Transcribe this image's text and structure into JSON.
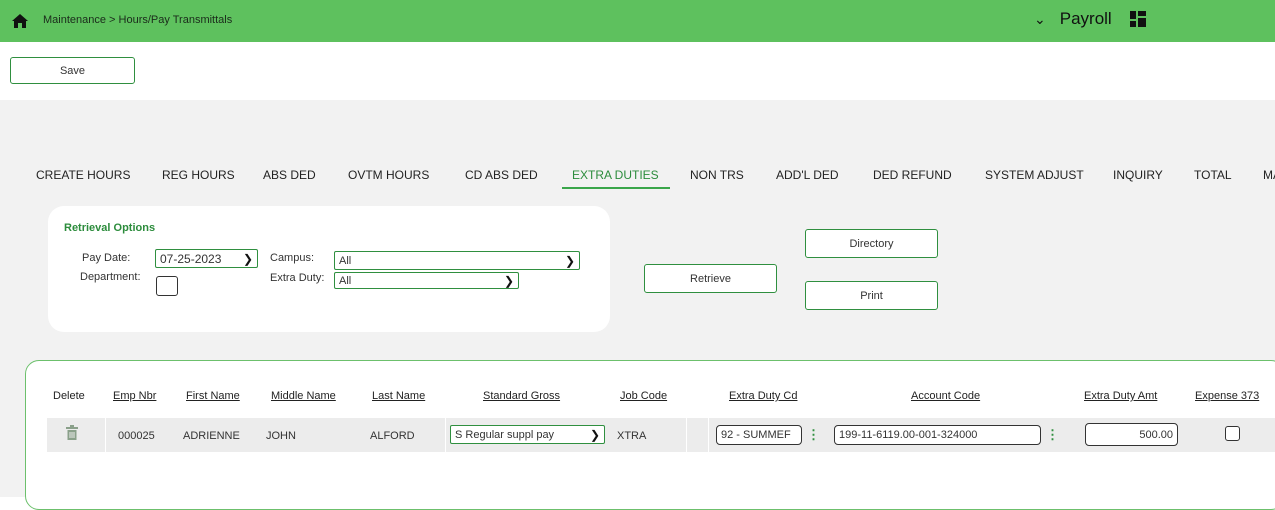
{
  "header": {
    "breadcrumb": "Maintenance > Hours/Pay Transmittals",
    "module": "Payroll",
    "home_icon": "home-icon",
    "apps_icon": "grid-icon"
  },
  "toolbar": {
    "save_label": "Save"
  },
  "tabs": [
    "CREATE HOURS",
    "REG HOURS",
    "ABS DED",
    "OVTM HOURS",
    "CD ABS DED",
    "EXTRA DUTIES",
    "NON TRS",
    "ADD'L DED",
    "DED REFUND",
    "SYSTEM ADJUST",
    "INQUIRY",
    "TOTAL",
    "MA"
  ],
  "active_tab": "EXTRA DUTIES",
  "retrieval": {
    "title": "Retrieval Options",
    "pay_date_label": "Pay Date:",
    "pay_date_value": "07-25-2023",
    "campus_label": "Campus:",
    "campus_value": "All",
    "department_label": "Department:",
    "extra_duty_label": "Extra Duty:",
    "extra_duty_value": "All"
  },
  "buttons": {
    "retrieve": "Retrieve",
    "directory": "Directory",
    "print": "Print"
  },
  "table": {
    "headers": {
      "delete": "Delete",
      "emp_nbr": "Emp Nbr",
      "first_name": "First Name",
      "middle_name": "Middle Name",
      "last_name": "Last Name",
      "standard_gross": "Standard Gross",
      "job_code": "Job Code",
      "extra_duty_cd": "Extra Duty Cd",
      "account_code": "Account Code",
      "extra_duty_amt": "Extra Duty Amt",
      "expense_373": "Expense 373"
    },
    "rows": [
      {
        "emp_nbr": "000025",
        "first_name": "ADRIENNE",
        "middle_name": "JOHN",
        "last_name": "ALFORD",
        "standard_gross": "S Regular suppl pay",
        "job_code": "XTRA",
        "extra_duty_cd": "92 - SUMMEF",
        "account_code": "199-11-6119.00-001-324000",
        "extra_duty_amt": "500.00",
        "expense_373": false
      }
    ]
  },
  "colors": {
    "topbar": "#5ec15e",
    "accent": "#2f8f3f",
    "background": "#f2f2f2"
  }
}
